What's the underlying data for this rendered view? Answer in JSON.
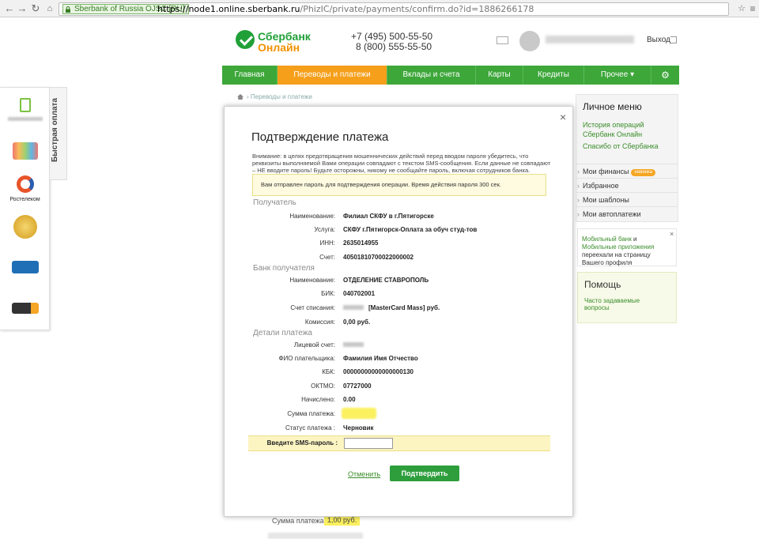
{
  "browser": {
    "cert_label": "Sberbank of Russia OJSC [RU]",
    "url_scheme": "https://",
    "url_host": "node1.online.sberbank.ru",
    "url_path": "/PhizIC/private/payments/confirm.do?id=1886266178"
  },
  "header": {
    "logo_line1": "Сбербанк",
    "logo_line2": "Онлайн",
    "phone1": "+7 (495) 500-55-50",
    "phone2": "8 (800) 555-55-50",
    "logout": "Выход"
  },
  "nav": {
    "items": [
      {
        "label": "Главная"
      },
      {
        "label": "Переводы и платежи"
      },
      {
        "label": "Вклады и счета"
      },
      {
        "label": "Карты"
      },
      {
        "label": "Кредиты"
      },
      {
        "label": "Прочее"
      }
    ],
    "more_arrow": "▾",
    "settings_icon": "⚙"
  },
  "breadcrumb": {
    "item": "Переводы и платежи"
  },
  "quick_pay": {
    "tab_label": "Быстрая оплата",
    "rostelecom_label": "Ростелеком"
  },
  "sidebar": {
    "title": "Личное меню",
    "links": [
      "История операций Сбербанк Онлайн",
      "Спасибо от Сбербанка"
    ],
    "items": [
      "Мои финансы",
      "Избранное",
      "Мои шаблоны",
      "Мои автоплатежи"
    ],
    "new_badge": "новинка",
    "mobile_text_pre": "Мобильный банк",
    "mobile_text_and": " и ",
    "mobile_text_link2": "Мобильные приложения",
    "mobile_text_post": " переехали на страницу Вашего профиля",
    "help_title": "Помощь",
    "help_link": "Часто задаваемые вопросы"
  },
  "background": {
    "sum_label": "Сумма платежа:",
    "sum_value": "1,00 руб."
  },
  "modal": {
    "title": "Подтверждение платежа",
    "warning": "Внимание: в целях предотвращения мошеннических действий перед вводом пароля убедитесь, что реквизиты выполняемой Вами операции совпадают с текстом SMS-сообщения. Если данные не совпадают – НЕ вводите пароль! Будьте осторожны, никому не сообщайте пароль, включая сотрудников банка.",
    "sms_notice": "Вам отправлен пароль для подтверждения операции. Время действия пароля 300 сек.",
    "sections": {
      "recipient": "Получатель",
      "bank": "Банк получателя",
      "details": "Детали платежа"
    },
    "recipient_fields": [
      {
        "label": "Наименование:",
        "value": "Филиал СКФУ в г.Пятигорске"
      },
      {
        "label": "Услуга:",
        "value": "СКФУ г.Пятигорск-Оплата за обуч студ-тов"
      },
      {
        "label": "ИНН:",
        "value": "2635014955"
      },
      {
        "label": "Счет:",
        "value": "40501810700022000002"
      }
    ],
    "bank_fields": [
      {
        "label": "Наименование:",
        "value": "ОТДЕЛЕНИЕ СТАВРОПОЛЬ"
      },
      {
        "label": "БИК:",
        "value": "040702001"
      },
      {
        "label": "Счет списания:",
        "value": "[MasterCard Mass]  руб."
      },
      {
        "label": "Комиссия:",
        "value": "0,00 руб."
      }
    ],
    "detail_fields": [
      {
        "label": "Лицевой счет:",
        "value": ""
      },
      {
        "label": "ФИО плательщика:",
        "value": "Фамилия Имя Отчество"
      },
      {
        "label": "КБК:",
        "value": "00000000000000000130"
      },
      {
        "label": "ОКТМО:",
        "value": "07727000"
      },
      {
        "label": "Начислено:",
        "value": "0.00"
      },
      {
        "label": "Сумма платежа:",
        "value": ""
      },
      {
        "label": "Статус платежа :",
        "value": "Черновик"
      }
    ],
    "sms_label": "Введите SMS-пароль :",
    "sms_value": "",
    "cancel": "Отменить",
    "confirm": "Подтвердить",
    "close_icon": "×"
  }
}
